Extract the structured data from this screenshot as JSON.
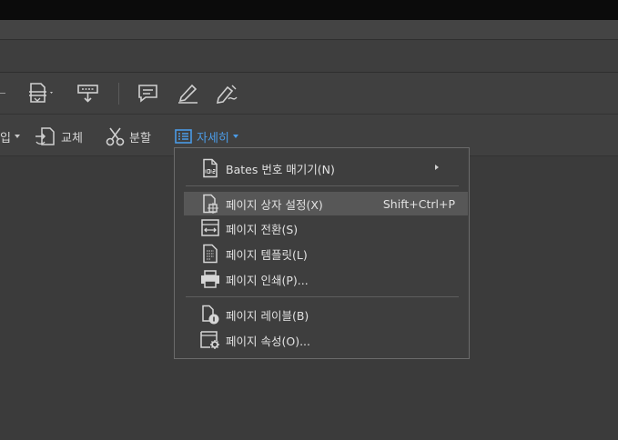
{
  "toolbar2": {
    "insert_label": "입",
    "replace_label": "교체",
    "split_label": "분할",
    "more_label": "자세히"
  },
  "menu": {
    "items": [
      {
        "label": "Bates 번호 매기기(N)",
        "has_submenu": true,
        "shortcut": "",
        "icon": "bates-numbering-icon"
      },
      {
        "label": "페이지 상자 설정(X)",
        "has_submenu": false,
        "shortcut": "Shift+Ctrl+P",
        "icon": "page-box-icon",
        "highlighted": true
      },
      {
        "label": "페이지 전환(S)",
        "has_submenu": false,
        "shortcut": "",
        "icon": "page-transition-icon"
      },
      {
        "label": "페이지 템플릿(L)",
        "has_submenu": false,
        "shortcut": "",
        "icon": "page-template-icon"
      },
      {
        "label": "페이지 인쇄(P)...",
        "has_submenu": false,
        "shortcut": "",
        "icon": "print-icon"
      },
      {
        "label": "페이지 레이블(B)",
        "has_submenu": false,
        "shortcut": "",
        "icon": "page-label-icon"
      },
      {
        "label": "페이지 속성(O)...",
        "has_submenu": false,
        "shortcut": "",
        "icon": "page-properties-icon"
      }
    ]
  },
  "colors": {
    "accent": "#4b9be6",
    "menu_bg": "#3e3e3e",
    "highlight": "#575757"
  }
}
